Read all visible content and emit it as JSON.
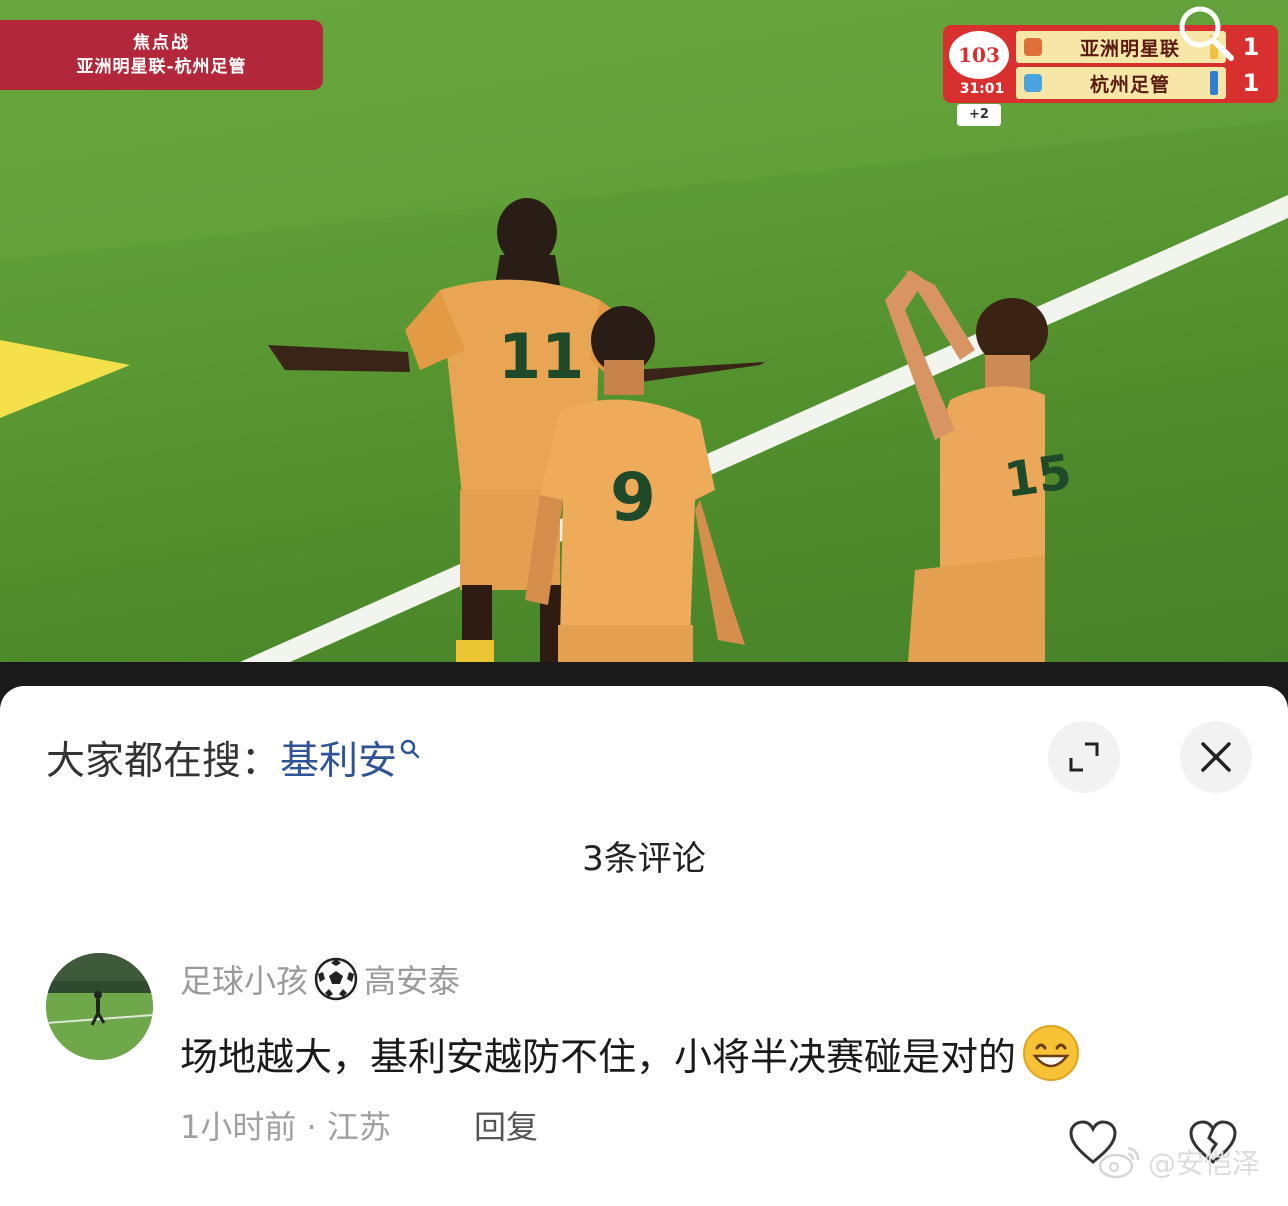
{
  "video": {
    "banner_line1": "焦点战",
    "banner_line2": "亚洲明星联-杭州足管",
    "scoreboard": {
      "time": "31:01",
      "logo_text": "103",
      "extra_time": "+2",
      "team1": "亚洲明星联",
      "team2": "杭州足管",
      "score1": "1",
      "score2": "1"
    },
    "jersey_numbers": [
      "11",
      "9",
      "15"
    ]
  },
  "panel": {
    "hot_search_prefix": "大家都在搜：",
    "hot_search_keyword": "基利安"
  },
  "comments_count_title": "3条评论",
  "comment": {
    "user_part1": "足球小孩",
    "user_part2": "高安泰",
    "text": "场地越大，基利安越防不住，小将半决赛碰是对的",
    "meta": "1小时前 · 江苏",
    "reply_label": "回复"
  },
  "watermark": "@安恺泽",
  "colors": {
    "pitch_green": "#5d9c35",
    "banner_red": "#b3273a",
    "scoreboard_red": "#d8302e",
    "jersey_orange": "#e8a655",
    "keyword_blue": "#2f5496"
  }
}
